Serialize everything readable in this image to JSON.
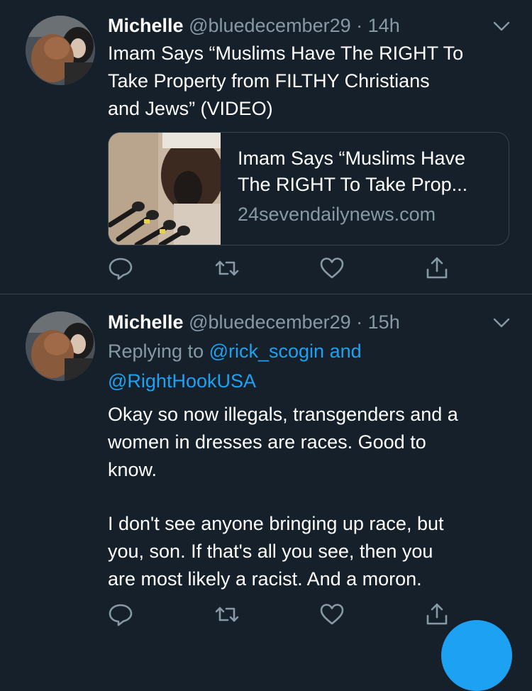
{
  "tweets": [
    {
      "name": "Michelle",
      "handle": "@bluedecember29",
      "sep": "·",
      "time": "14h",
      "text_lines": [
        "Imam Says “Muslims Have The RIGHT To",
        "Take Property from FILTHY Christians",
        "and Jews” (VIDEO)"
      ],
      "card": {
        "title_lines": [
          "Imam Says “Muslims Have",
          "The RIGHT To Take Prop..."
        ],
        "domain": "24sevendailynews.com"
      }
    },
    {
      "name": "Michelle",
      "handle": "@bluedecember29",
      "sep": "·",
      "time": "15h",
      "replying_prefix": "Replying to",
      "replying_user1": "@rick_scogin",
      "replying_and": "and",
      "replying_user2": "@RightHookUSA",
      "para1_lines": [
        "Okay so now illegals, transgenders and a",
        "women in dresses are races. Good to",
        "know."
      ],
      "para2_lines": [
        "I don't see anyone bringing up race, but",
        "you, son. If that's all you see, then you",
        "are most likely a racist. And a moron."
      ]
    }
  ],
  "icons": [
    "reply-icon",
    "retweet-icon",
    "like-icon",
    "share-icon",
    "chevron-down-icon"
  ],
  "colors": {
    "background": "#15202b",
    "text": "#ffffff",
    "muted": "#8899a6",
    "accent": "#1da1f2",
    "border": "#38444d"
  }
}
